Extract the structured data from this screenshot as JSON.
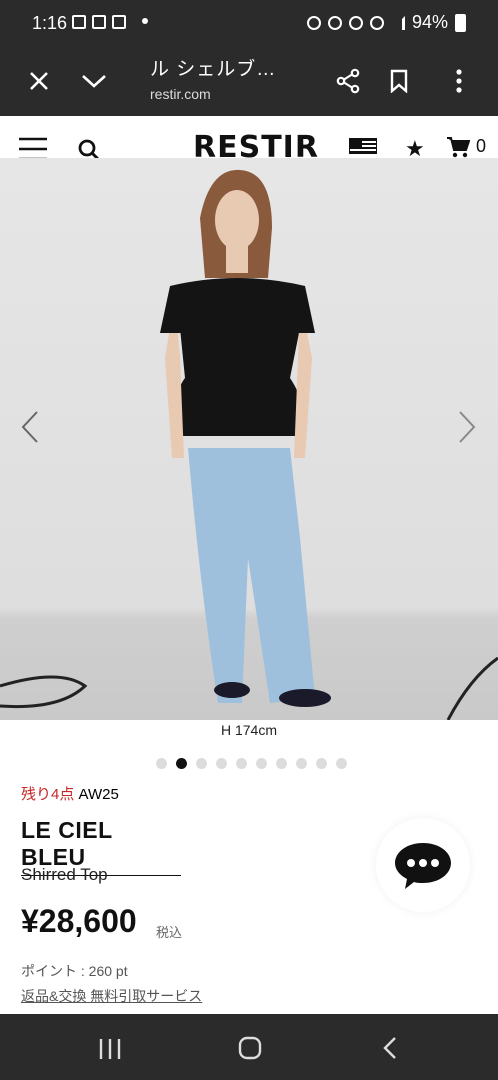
{
  "status_bar": {
    "time": "1:16",
    "battery": "94%"
  },
  "browser": {
    "title": "ル シェルブ…",
    "url": "restir.com"
  },
  "site": {
    "logo": "RESTIR",
    "cart_count": "0"
  },
  "product": {
    "photo_caption": "H 174cm",
    "image_count": 10,
    "active_image_index": 1,
    "stock_note": "残り4点",
    "season": "AW25",
    "brand": "LE CIEL BLEU",
    "name": "Shirred Top",
    "price": "¥28,600",
    "tax_note": "税込",
    "points": "ポイント : 260 pt",
    "returns_link": "返品&交換 無料引取サービス"
  },
  "colors": {
    "stock_red": "#c62828",
    "top_bar": "#2b2b2b"
  }
}
